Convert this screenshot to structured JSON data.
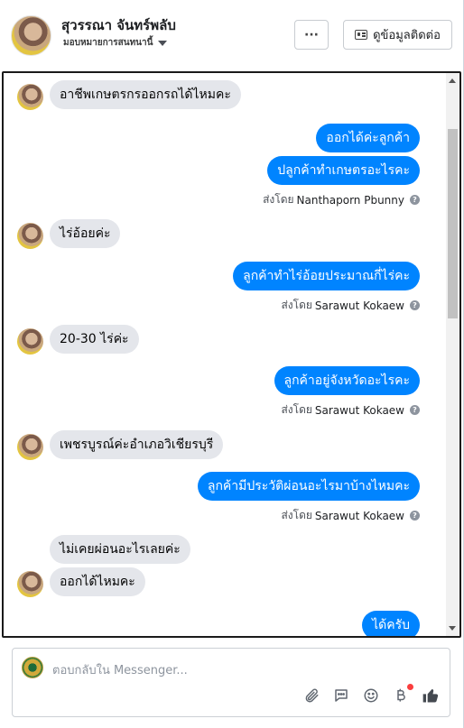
{
  "header": {
    "name": "สุวรรณา จันทร์พลับ",
    "assignment_label": "มอบหมายการสนทนานี้",
    "more_label": "···",
    "contact_label": "ดูข้อมูลติดต่อ"
  },
  "messages": [
    {
      "side": "in",
      "text": "อาชีพเกษตรกรออกรถได้ไหมคะ"
    },
    {
      "side": "out",
      "text": "ออกได้ค่ะลูกค้า"
    },
    {
      "side": "out",
      "text": "ปลูกค้าทำเกษตรอะไรคะ"
    },
    {
      "side": "meta",
      "prefix": "ส่งโดย",
      "name": "Nanthaporn Pbunny"
    },
    {
      "side": "in",
      "text": "ไร่อ้อยค่ะ"
    },
    {
      "side": "out",
      "text": "ลูกค้าทำไร่อ้อยประมาณกี่ไร่คะ"
    },
    {
      "side": "meta",
      "prefix": "ส่งโดย",
      "name": "Sarawut Kokaew"
    },
    {
      "side": "in",
      "text": "20-30 ไร่ค่ะ"
    },
    {
      "side": "out",
      "text": "ลูกค้าอยู่จังหวัดอะไรคะ"
    },
    {
      "side": "meta",
      "prefix": "ส่งโดย",
      "name": "Sarawut Kokaew"
    },
    {
      "side": "in",
      "text": "เพชรบูรณ์ค่ะอำเภอวิเชียรบุรี"
    },
    {
      "side": "out",
      "text": "ลูกค้ามีประวัติผ่อนอะไรมาบ้างไหมคะ"
    },
    {
      "side": "meta",
      "prefix": "ส่งโดย",
      "name": "Sarawut Kokaew"
    },
    {
      "side": "in",
      "text": "ไม่เคยผ่อนอะไรเลยค่ะ"
    },
    {
      "side": "in",
      "text": "ออกได้ไหมคะ"
    },
    {
      "side": "out",
      "text": "ได้ครับ"
    }
  ],
  "composer": {
    "placeholder": "ตอบกลับใน Messenger..."
  },
  "icons": {
    "attach": "paperclip-icon",
    "sticker": "chat-bubble-icon",
    "emoji": "emoji-icon",
    "payment": "baht-icon",
    "like": "thumbs-up-icon"
  },
  "colors": {
    "outgoing_bubble": "#0084ff",
    "incoming_bubble": "#e4e6eb",
    "like_icon": "#444950",
    "badge": "#fa3e3e"
  }
}
